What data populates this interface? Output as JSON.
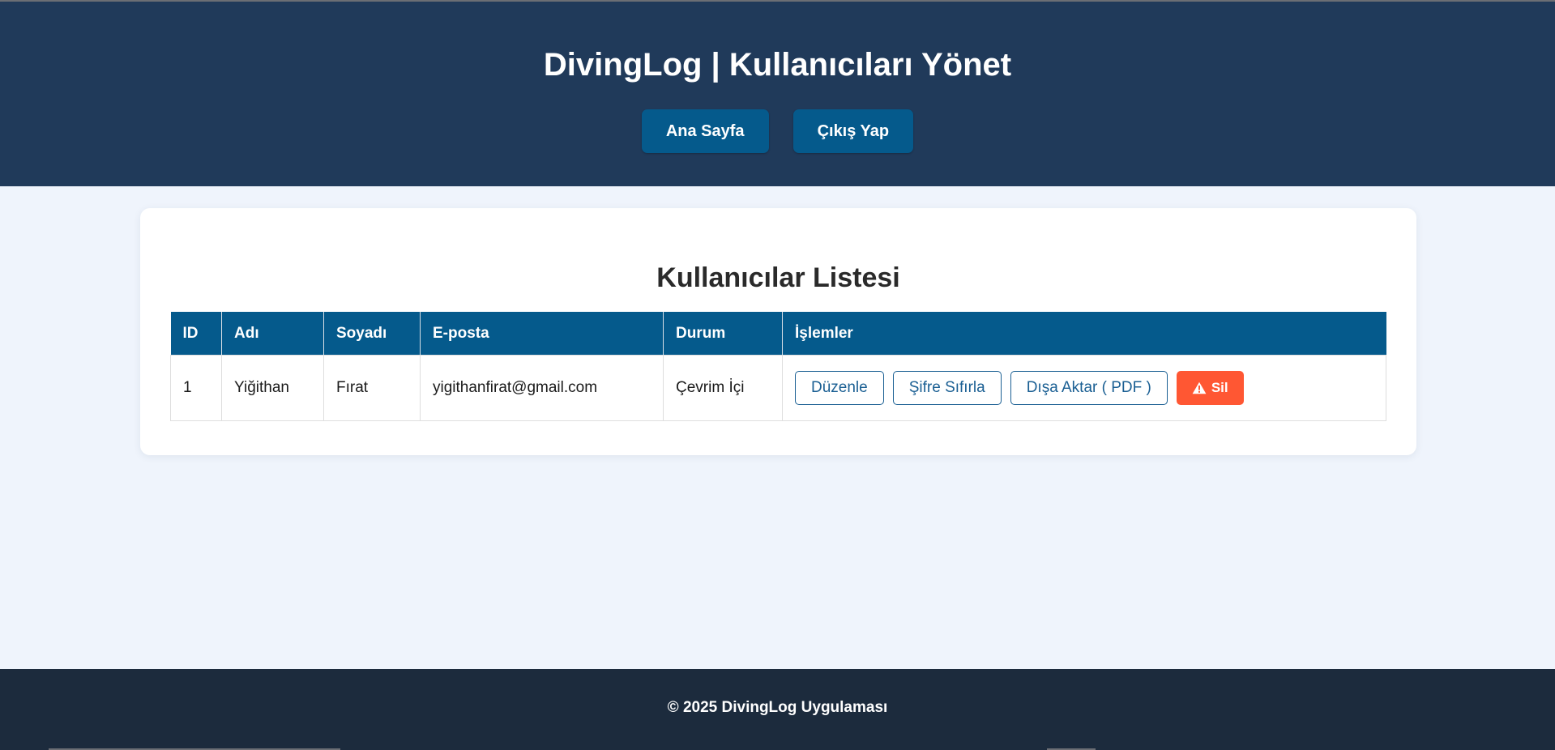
{
  "header": {
    "title": "DivingLog | Kullanıcıları Yönet",
    "nav": {
      "home_label": "Ana Sayfa",
      "logout_label": "Çıkış Yap"
    }
  },
  "card": {
    "title": "Kullanıcılar Listesi",
    "table": {
      "columns": [
        "ID",
        "Adı",
        "Soyadı",
        "E-posta",
        "Durum",
        "İşlemler"
      ],
      "rows": [
        {
          "id": "1",
          "first_name": "Yiğithan",
          "last_name": "Fırat",
          "email": "yigithanfirat@gmail.com",
          "status": "Çevrim İçi",
          "actions": {
            "edit_label": "Düzenle",
            "reset_password_label": "Şifre Sıfırla",
            "export_label": "Dışa Aktar ( PDF )",
            "delete_label": "Sil",
            "delete_icon": "warning-icon"
          }
        }
      ]
    }
  },
  "footer": {
    "text": "© 2025 DivingLog Uygulaması"
  },
  "colors": {
    "header_bg": "#203a5a",
    "primary": "#055a8c",
    "danger": "#ff5733",
    "page_bg": "#eff4fc",
    "footer_bg": "#1c2b3d"
  }
}
